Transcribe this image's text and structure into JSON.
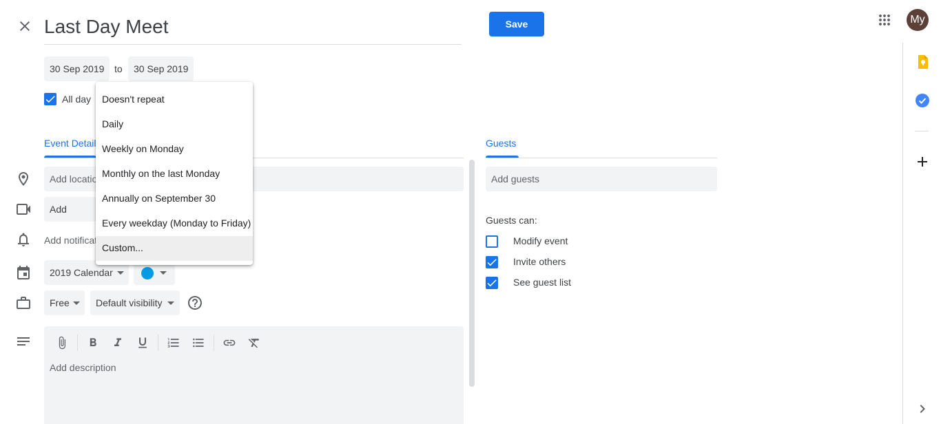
{
  "event": {
    "title": "Last Day Meet",
    "save_label": "Save",
    "avatar_initials": "My",
    "date_start": "30 Sep 2019",
    "date_to": "to",
    "date_end": "30 Sep 2019",
    "all_day_label": "All day"
  },
  "repeat_menu": {
    "items": [
      "Doesn't repeat",
      "Daily",
      "Weekly on Monday",
      "Monthly on the last Monday",
      "Annually on September 30",
      "Every weekday (Monday to Friday)",
      "Custom..."
    ]
  },
  "tabs": {
    "event_details": "Event Details",
    "guests": "Guests"
  },
  "details": {
    "location_placeholder": "Add location",
    "conference_label": "Add conferencing",
    "notification_label": "Add notification",
    "calendar_select": "2019 Calendar",
    "calendar_color": "#039be5",
    "availability": "Free",
    "visibility": "Default visibility",
    "description_placeholder": "Add description"
  },
  "guests": {
    "add_placeholder": "Add guests",
    "guests_can": "Guests can:",
    "permissions": [
      {
        "label": "Modify event",
        "checked": false
      },
      {
        "label": "Invite others",
        "checked": true
      },
      {
        "label": "See guest list",
        "checked": true
      }
    ]
  },
  "colors": {
    "accent": "#1a73e8",
    "keep": "#fbbc04",
    "tasks": "#4285f4"
  }
}
